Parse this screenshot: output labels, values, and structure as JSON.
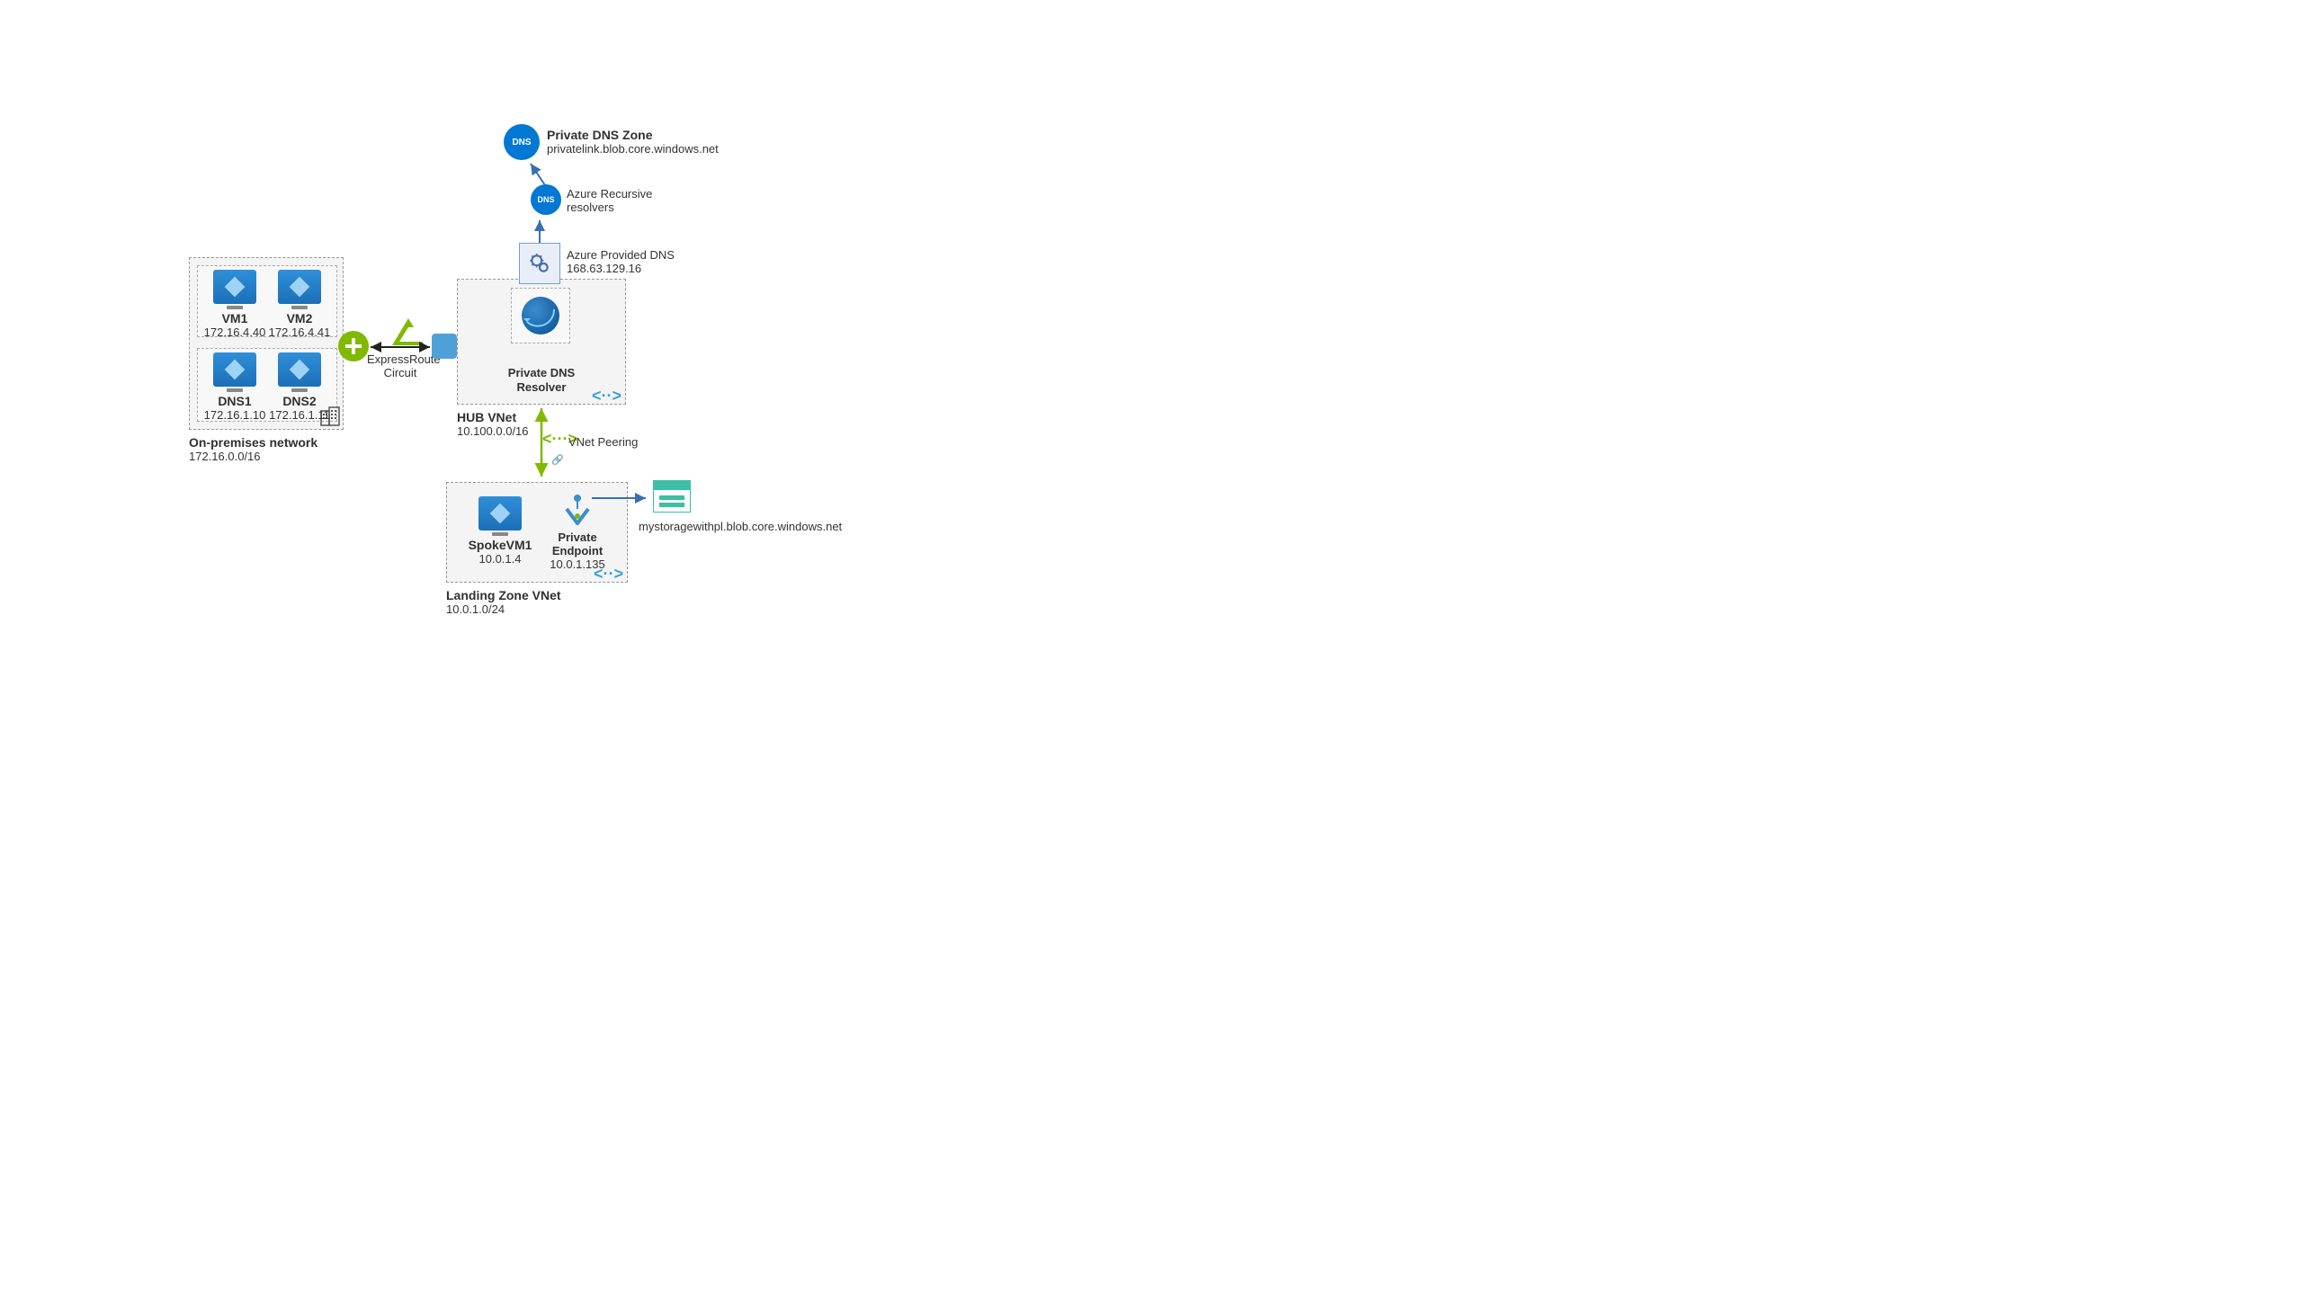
{
  "onprem": {
    "title": "On-premises network",
    "cidr": "172.16.0.0/16",
    "vm1": {
      "name": "VM1",
      "ip": "172.16.4.40"
    },
    "vm2": {
      "name": "VM2",
      "ip": "172.16.4.41"
    },
    "dns1": {
      "name": "DNS1",
      "ip": "172.16.1.10"
    },
    "dns2": {
      "name": "DNS2",
      "ip": "172.16.1.11"
    }
  },
  "expressroute": {
    "label": "ExpressRoute\nCircuit"
  },
  "hub": {
    "title": "HUB VNet",
    "cidr": "10.100.0.0/16",
    "resolver": "Private DNS\nResolver"
  },
  "azure_dns": {
    "label": "Azure Provided DNS",
    "ip": "168.63.129.16"
  },
  "recursive": {
    "label": "Azure Recursive\nresolvers"
  },
  "private_zone": {
    "title": "Private DNS Zone",
    "fqdn": "privatelink.blob.core.windows.net"
  },
  "peering": {
    "label": "VNet Peering"
  },
  "landing": {
    "title": "Landing Zone VNet",
    "cidr": "10.0.1.0/24",
    "spoke": {
      "name": "SpokeVM1",
      "ip": "10.0.1.4"
    },
    "pe": {
      "name": "Private\nEndpoint",
      "ip": "10.0.1.135"
    }
  },
  "storage": {
    "fqdn": "mystoragewithpl.blob.core.windows.net"
  }
}
